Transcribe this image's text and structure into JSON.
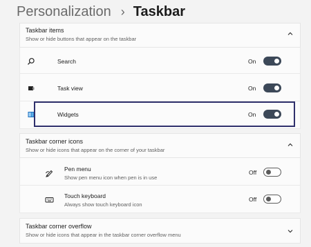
{
  "breadcrumb": {
    "parent": "Personalization",
    "separator": "›",
    "current": "Taskbar"
  },
  "sections": {
    "taskbar_items": {
      "title": "Taskbar items",
      "subtitle": "Show or hide buttons that appear on the taskbar",
      "expanded": true,
      "rows": [
        {
          "label": "Search",
          "icon": "search-icon",
          "state": "On",
          "on": true
        },
        {
          "label": "Task view",
          "icon": "task-view-icon",
          "state": "On",
          "on": true
        },
        {
          "label": "Widgets",
          "icon": "widgets-icon",
          "state": "On",
          "on": true,
          "highlighted": true
        }
      ]
    },
    "corner_icons": {
      "title": "Taskbar corner icons",
      "subtitle": "Show or hide icons that appear on the corner of your taskbar",
      "expanded": true,
      "rows": [
        {
          "label": "Pen menu",
          "sublabel": "Show pen menu icon when pen is in use",
          "icon": "pen-icon",
          "state": "Off",
          "on": false
        },
        {
          "label": "Touch keyboard",
          "sublabel": "Always show touch keyboard icon",
          "icon": "keyboard-icon",
          "state": "Off",
          "on": false
        }
      ]
    },
    "corner_overflow": {
      "title": "Taskbar corner overflow",
      "subtitle": "Show or hide icons that appear in the taskbar corner overflow menu",
      "expanded": false
    }
  },
  "colors": {
    "toggle_on": "#3c4858",
    "highlight_border": "#2e2f6b",
    "background": "#f3f3f3",
    "card": "#fbfbfb"
  }
}
